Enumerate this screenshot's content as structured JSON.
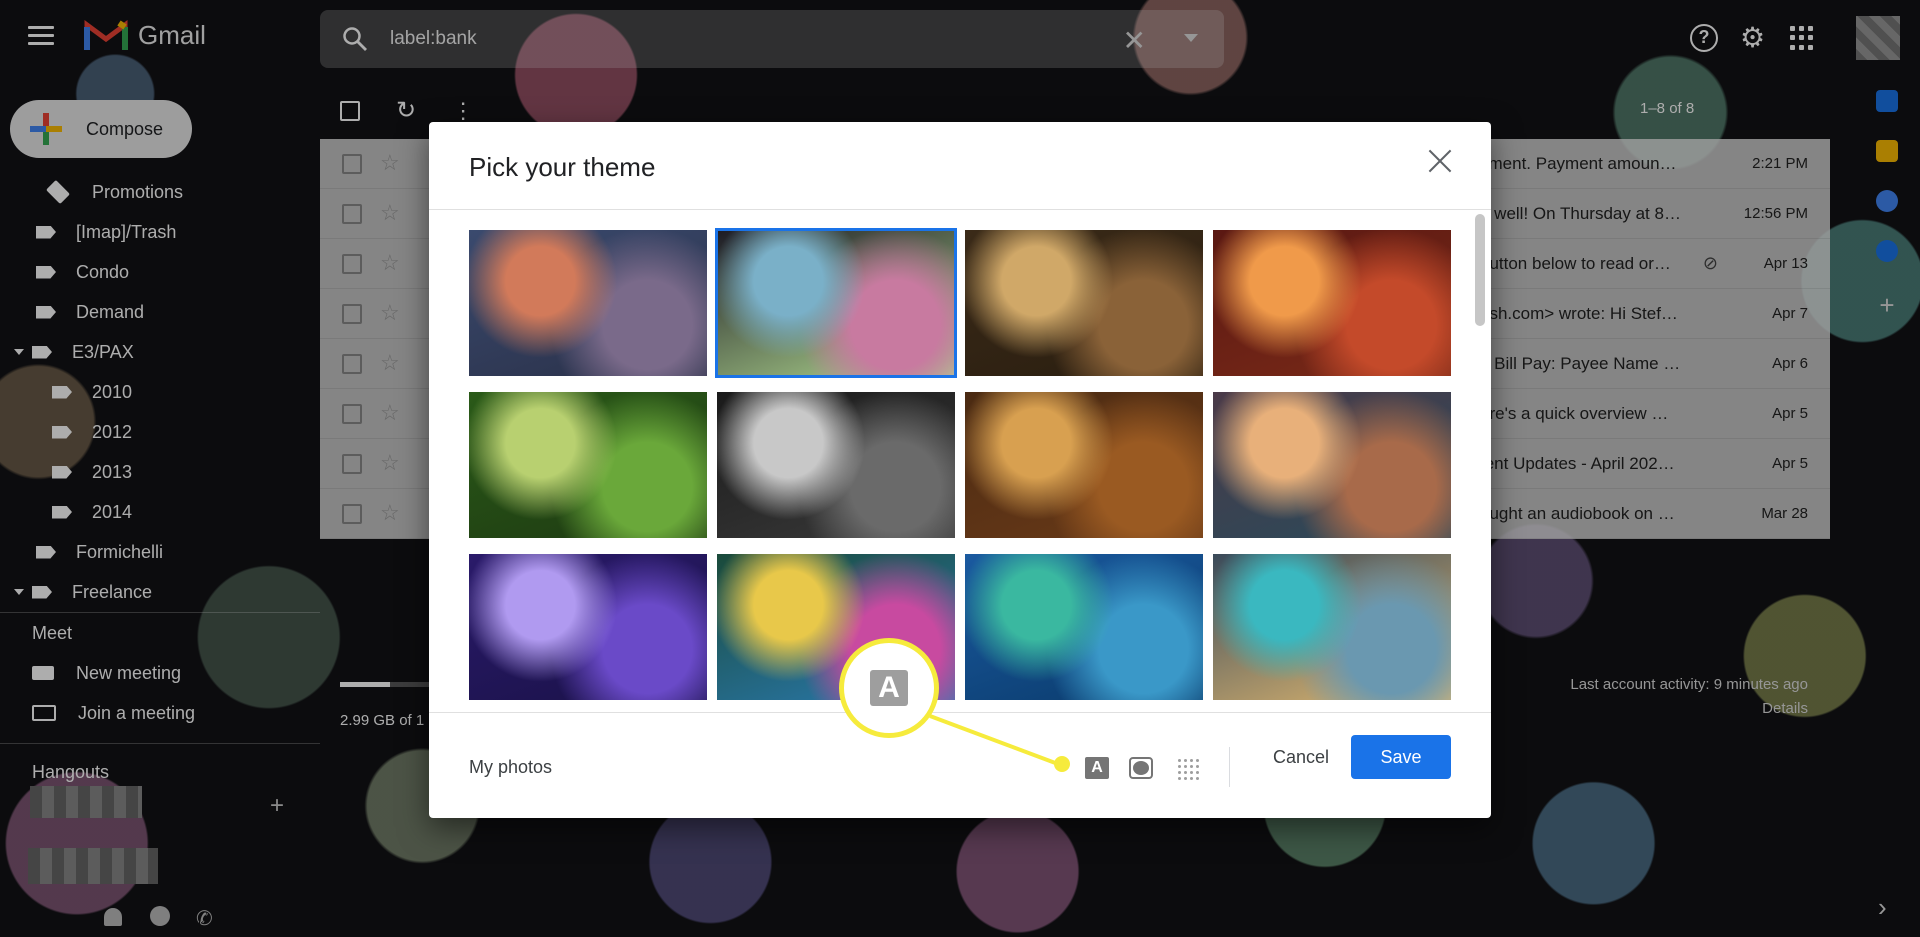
{
  "app": {
    "name": "Gmail"
  },
  "search": {
    "query": "label:bank"
  },
  "compose": {
    "label": "Compose"
  },
  "sidebar": {
    "labels": [
      {
        "name": "Promotions",
        "indent": 1
      },
      {
        "name": "[Imap]/Trash",
        "indent": 0
      },
      {
        "name": "Condo",
        "indent": 0
      },
      {
        "name": "Demand",
        "indent": 0
      },
      {
        "name": "E3/PAX",
        "indent": 0,
        "expanded": true
      },
      {
        "name": "2010",
        "indent": 1
      },
      {
        "name": "2012",
        "indent": 1
      },
      {
        "name": "2013",
        "indent": 1
      },
      {
        "name": "2014",
        "indent": 1
      },
      {
        "name": "Formichelli",
        "indent": 0
      },
      {
        "name": "Freelance",
        "indent": 0,
        "expanded": true
      }
    ],
    "meet": {
      "title": "Meet",
      "new_meeting": "New meeting",
      "join_meeting": "Join a meeting"
    },
    "hangouts": {
      "title": "Hangouts"
    }
  },
  "mail": {
    "pagination": "1–8 of 8",
    "rows": [
      {
        "snippet": "yment. Payment amoun…",
        "date": "2:21 PM"
      },
      {
        "snippet": "g well! On Thursday at 8…",
        "date": "12:56 PM"
      },
      {
        "snippet": "button below to read or…",
        "date": "Apr 13",
        "attachment": true
      },
      {
        "snippet": "ash.com> wrote: Hi Stef…",
        "date": "Apr 7"
      },
      {
        "snippet": "n Bill Pay: Payee Name …",
        "date": "Apr 6"
      },
      {
        "snippet": "ere's a quick overview …",
        "date": "Apr 5"
      },
      {
        "snippet": "tent Updates - April 202…",
        "date": "Apr 5"
      },
      {
        "snippet": "ought an audiobook on …",
        "date": "Mar 28"
      }
    ],
    "storage": "2.99 GB of 1",
    "storage_fraction": 0.25,
    "last_activity": "Last account activity: 9 minutes ago",
    "details": "Details"
  },
  "dialog": {
    "title": "Pick your theme",
    "my_photos": "My photos",
    "cancel": "Cancel",
    "save": "Save",
    "selected_theme_index": 1,
    "themes": [
      {
        "name": "stormy-sunset",
        "colors": [
          "#3a4a6e",
          "#7a6a8a",
          "#d27a5a",
          "#2a3048"
        ]
      },
      {
        "name": "bokeh-lights",
        "colors": [
          "#1c1a24",
          "#c87aa0",
          "#7ab0c8",
          "#b0d890"
        ]
      },
      {
        "name": "chess-pieces",
        "colors": [
          "#3a2a18",
          "#8a6238",
          "#d0a868",
          "#2a1e10"
        ]
      },
      {
        "name": "red-canyon",
        "colors": [
          "#5a1812",
          "#c44a2a",
          "#f09a4a",
          "#7a2a18"
        ]
      },
      {
        "name": "caterpillar",
        "colors": [
          "#2a5a18",
          "#6aa83a",
          "#b8d070",
          "#1e3a12"
        ]
      },
      {
        "name": "metal-tubes",
        "colors": [
          "#1a1a1a",
          "#6a6a6a",
          "#c8c8c8",
          "#3a3a3a"
        ]
      },
      {
        "name": "autumn-leaves",
        "colors": [
          "#4a2a12",
          "#9a5a22",
          "#d8a050",
          "#6a3a18"
        ]
      },
      {
        "name": "river-canyon",
        "colors": [
          "#4a3a48",
          "#a86a4a",
          "#e8b07a",
          "#2a4a5a"
        ]
      },
      {
        "name": "jellyfish",
        "colors": [
          "#2a1a6a",
          "#6a4ac8",
          "#b09af0",
          "#1a1248"
        ]
      },
      {
        "name": "rainbow-droplet",
        "colors": [
          "#1a4a3a",
          "#c84aa0",
          "#e8c84a",
          "#2a7ab0"
        ]
      },
      {
        "name": "lake-shore",
        "colors": [
          "#1a5aa0",
          "#3a98c8",
          "#3ab8a0",
          "#0a3a6a"
        ]
      },
      {
        "name": "beach",
        "colors": [
          "#3a4a5a",
          "#6a98b0",
          "#3ab8c0",
          "#e0b870"
        ]
      },
      {
        "name": "theme-13",
        "colors": [
          "#6a8a3a",
          "#8a9a4a",
          "#a8b070",
          "#4a6a2a"
        ]
      },
      {
        "name": "theme-14",
        "colors": [
          "#2a6aa8",
          "#5a98c8",
          "#88b8e0",
          "#1a4a8a"
        ]
      },
      {
        "name": "theme-15",
        "colors": [
          "#5a3a28",
          "#8a6a4a",
          "#b8986a",
          "#3a2418"
        ]
      },
      {
        "name": "theme-16",
        "colors": [
          "#1a3a8a",
          "#3a5ab0",
          "#6a88d0",
          "#0a2260"
        ]
      }
    ],
    "options": {
      "text_background": "A",
      "text_background_icon": "text-background-icon",
      "vignette_icon": "vignette-icon",
      "blur_icon": "blur-icon"
    }
  },
  "callout": {
    "glyph": "A",
    "color": "#f6eb3c"
  }
}
